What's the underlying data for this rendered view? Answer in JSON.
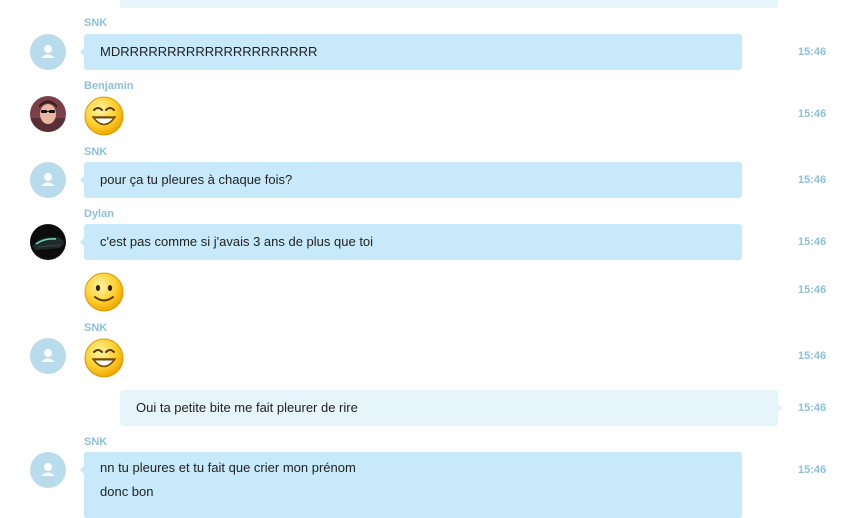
{
  "messages": [
    {
      "sender": "SNK",
      "text": "MDRRRRRRRRRRRRRRRRRRRRR",
      "time": "15:46"
    },
    {
      "sender": "Benjamin",
      "emoji": "grinning-face-emoji",
      "time": "15:46"
    },
    {
      "sender": "SNK",
      "text": "pour ça tu pleures à chaque fois?",
      "time": "15:46"
    },
    {
      "sender": "Dylan",
      "text": "c'est pas comme si j'avais 3 ans de plus que toi",
      "time": "15:46"
    },
    {
      "emoji": "smiling-face-emoji",
      "time": "15:46"
    },
    {
      "sender": "SNK",
      "emoji": "grinning-face-emoji",
      "time": "15:46"
    },
    {
      "text": "Oui ta petite bite me fait pleurer de rire",
      "time": "15:46",
      "outgoing": true
    },
    {
      "sender": "SNK",
      "lines": [
        "nn tu pleures et tu fait que crier mon prénom",
        "donc bon"
      ],
      "time": "15:46"
    }
  ],
  "colors": {
    "incoming_bubble": "#c7e9f9",
    "outgoing_bubble": "#e6f4fb",
    "meta_text": "#8fbfd6",
    "default_avatar": "#b9dcec"
  }
}
